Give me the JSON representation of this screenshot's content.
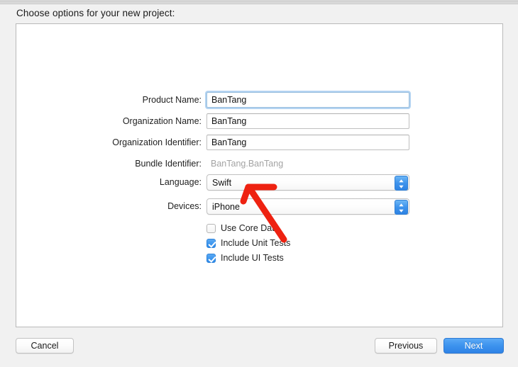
{
  "dialog": {
    "prompt": "Choose options for your new project:"
  },
  "form": {
    "fields": [
      {
        "label": "Product Name:",
        "value": "BanTang",
        "type": "text",
        "focused": true
      },
      {
        "label": "Organization Name:",
        "value": "BanTang",
        "type": "text",
        "focused": false
      },
      {
        "label": "Organization Identifier:",
        "value": "BanTang",
        "type": "text",
        "focused": false
      },
      {
        "label": "Bundle Identifier:",
        "value": "BanTang.BanTang",
        "type": "static",
        "focused": false
      },
      {
        "label": "Language:",
        "value": "Swift",
        "type": "popup",
        "focused": false
      },
      {
        "label": "Devices:",
        "value": "iPhone",
        "type": "popup",
        "focused": false
      }
    ],
    "checkboxes": [
      {
        "label": "Use Core Data",
        "checked": false
      },
      {
        "label": "Include Unit Tests",
        "checked": true
      },
      {
        "label": "Include UI Tests",
        "checked": true
      }
    ]
  },
  "footer": {
    "cancel_label": "Cancel",
    "previous_label": "Previous",
    "next_label": "Next"
  },
  "annotation": {
    "color": "#ee2211",
    "points_to": "Language:"
  },
  "colors": {
    "accent_blue": "#3e93ec",
    "checkbox_blue": "#3e97ef",
    "focus_ring": "#74afe5",
    "panel_bg": "#ffffff",
    "window_bg": "#f1f1f1",
    "static_text": "#a3a3a3",
    "annotation_red": "#ee2211"
  }
}
